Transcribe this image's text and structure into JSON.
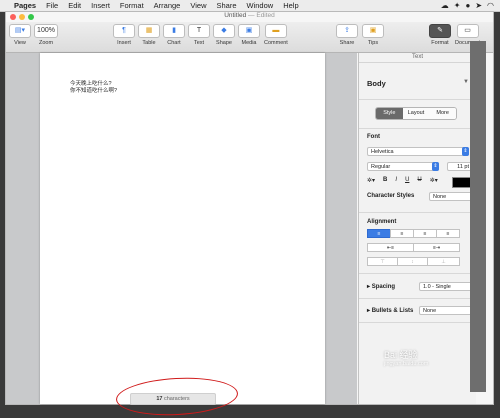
{
  "menubar": {
    "app": "Pages",
    "items": [
      "File",
      "Edit",
      "Insert",
      "Format",
      "Arrange",
      "View",
      "Share",
      "Window",
      "Help"
    ]
  },
  "window": {
    "title": "Untitled",
    "status": "— Edited"
  },
  "toolbar": {
    "view": "View",
    "zoom_value": "100%",
    "zoom_label": "Zoom",
    "insert": "Insert",
    "table": "Table",
    "chart": "Chart",
    "text": "Text",
    "shape": "Shape",
    "media": "Media",
    "comment": "Comment",
    "share": "Share",
    "tips": "Tips",
    "format": "Format",
    "document": "Document"
  },
  "document": {
    "lines": [
      "今天晚上吃什么?",
      "你不知道吃什么啊?"
    ],
    "status_count": "17",
    "status_unit": "characters"
  },
  "inspector": {
    "header": "Text",
    "style": "Body",
    "tabs": [
      "Style",
      "Layout",
      "More"
    ],
    "font_section": "Font",
    "font_family": "Helvetica",
    "font_weight": "Regular",
    "font_size": "11 pt",
    "char_styles_label": "Character Styles",
    "char_styles_value": "None",
    "alignment_section": "Alignment",
    "spacing_label": "Spacing",
    "spacing_value": "1.0 - Single",
    "bullets_label": "Bullets & Lists",
    "bullets_value": "None"
  },
  "watermark": {
    "main": "Bai 经验",
    "sub": "jingyan.baidu.com"
  }
}
